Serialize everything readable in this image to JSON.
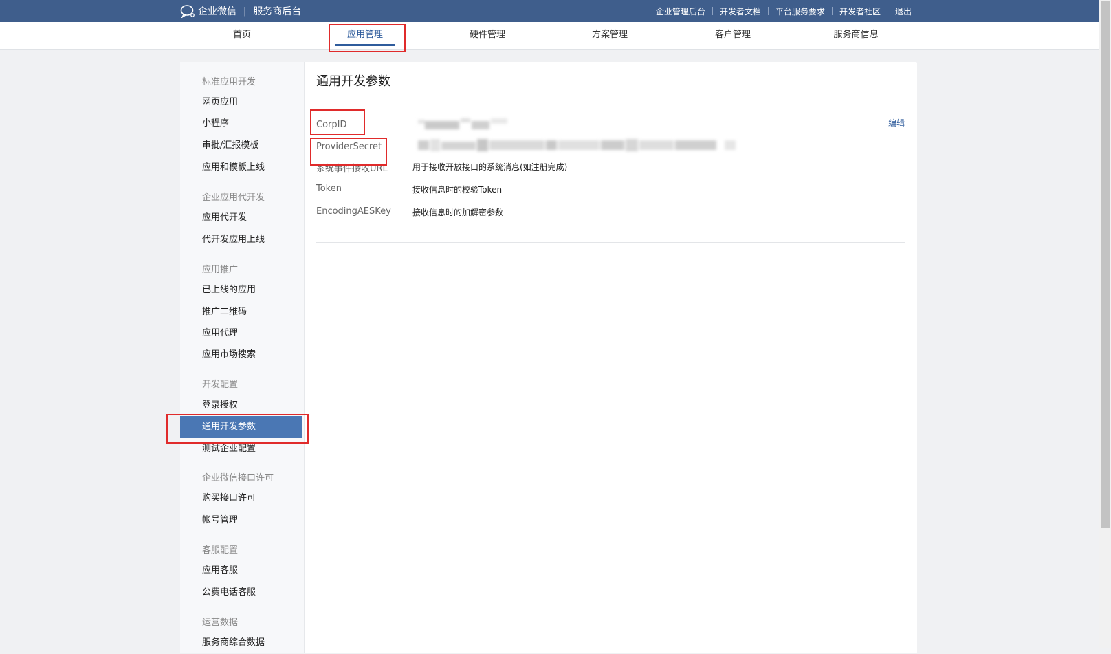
{
  "topbar": {
    "brand_name": "企业微信",
    "brand_sub": "服务商后台",
    "links": [
      "企业管理后台",
      "开发者文档",
      "平台服务要求",
      "开发者社区",
      "退出"
    ]
  },
  "nav": {
    "tabs": [
      "首页",
      "应用管理",
      "硬件管理",
      "方案管理",
      "客户管理",
      "服务商信息"
    ],
    "active": "应用管理"
  },
  "sidebar": {
    "groups": [
      {
        "label": "标准应用开发",
        "items": [
          "网页应用",
          "小程序",
          "审批/汇报模板",
          "应用和模板上线"
        ]
      },
      {
        "label": "企业应用代开发",
        "items": [
          "应用代开发",
          "代开发应用上线"
        ]
      },
      {
        "label": "应用推广",
        "items": [
          "已上线的应用",
          "推广二维码",
          "应用代理",
          "应用市场搜索"
        ]
      },
      {
        "label": "开发配置",
        "items": [
          "登录授权",
          "通用开发参数",
          "测试企业配置"
        ]
      },
      {
        "label": "企业微信接口许可",
        "items": [
          "购买接口许可",
          "帐号管理"
        ]
      },
      {
        "label": "客服配置",
        "items": [
          "应用客服",
          "公费电话客服"
        ]
      },
      {
        "label": "运营数据",
        "items": [
          "服务商综合数据"
        ]
      }
    ],
    "active_item": "通用开发参数"
  },
  "content": {
    "title": "通用开发参数",
    "edit_label": "编辑",
    "params": [
      {
        "label": "CorpID",
        "value": ""
      },
      {
        "label": "ProviderSecret",
        "value": ""
      },
      {
        "label": "系统事件接收URL",
        "value": "用于接收开放接口的系统消息(如注册完成)"
      },
      {
        "label": "Token",
        "value": "接收信息时的校验Token"
      },
      {
        "label": "EncodingAESKey",
        "value": "接收信息时的加解密参数"
      }
    ]
  },
  "colors": {
    "topbar": "#3f5e8c",
    "accent": "#2f5c9c",
    "sidebar_active": "#4a77b4",
    "highlight_box": "#e02b2b"
  }
}
